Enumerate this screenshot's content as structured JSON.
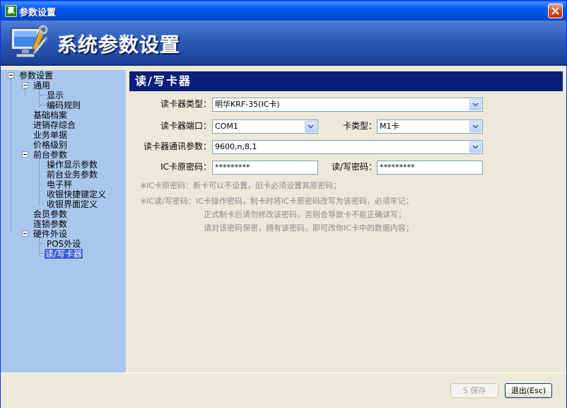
{
  "window": {
    "title": "参数设置",
    "banner_title": "系统参数设置",
    "app_icon_glyph": "赢"
  },
  "sidebar": {
    "items": [
      {
        "label": "参数设置"
      },
      {
        "label": "通用"
      },
      {
        "label": "显示"
      },
      {
        "label": "编码规则"
      },
      {
        "label": "基础档案"
      },
      {
        "label": "进销存综合"
      },
      {
        "label": "业务单据"
      },
      {
        "label": "价格级别"
      },
      {
        "label": "前台参数"
      },
      {
        "label": "操作显示参数"
      },
      {
        "label": "前台业务参数"
      },
      {
        "label": "电子秤"
      },
      {
        "label": "收银快捷键定义"
      },
      {
        "label": "收银界面定义"
      },
      {
        "label": "会员参数"
      },
      {
        "label": "连锁参数"
      },
      {
        "label": "硬件外设"
      },
      {
        "label": "POS外设"
      },
      {
        "label": "读/写卡器"
      }
    ],
    "selected": "读/写卡器"
  },
  "main": {
    "section_title": "读/写卡器",
    "reader_type": {
      "label": "读卡器类型：",
      "value": "明华KRF-35(IC卡)"
    },
    "reader_port": {
      "label": "读卡器端口：",
      "value": "COM1"
    },
    "card_type": {
      "label": "卡类型：",
      "value": "M1卡"
    },
    "comm_params": {
      "label": "读卡器通讯参数：",
      "value": "9600,n,8,1"
    },
    "ic_password": {
      "label": "IC卡原密码：",
      "value": "*********"
    },
    "rw_password": {
      "label": "读/写密码：",
      "value": "*********"
    },
    "notes": [
      "※IC卡原密码：新卡可以不设置，旧卡必须设置其原密码；",
      "※IC读/写密码：IC卡操作密码，制卡时将IC卡原密码改写为该密码，必须牢记；",
      "正式制卡后请勿修改该密码，否则会导致卡不能正确读写；",
      "请对该密码保密，拥有该密码，即可改你IC卡中的数据内容；"
    ]
  },
  "footer": {
    "save_label": "S 保存",
    "exit_label": "退出(Esc)"
  },
  "colors": {
    "titlebar": "#0058ee",
    "sidebar_bg": "#a9c7ec",
    "section_header_bg": "#0a1e7a",
    "note_text": "#8a8a8a"
  }
}
